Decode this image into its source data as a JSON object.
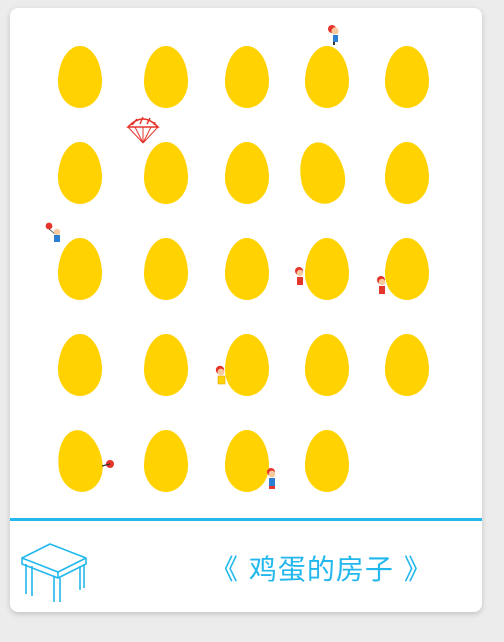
{
  "colors": {
    "egg": "#FFD200",
    "accent": "#22B8EE",
    "background": "#FFFFFF",
    "figure_shirt": "#2A7FD4",
    "figure_red": "#E6352B",
    "figure_skin": "#F6C9A0"
  },
  "title": "《 鸡蛋的房子 》",
  "eggs": [
    {
      "row": 1,
      "count": 5
    },
    {
      "row": 2,
      "count": 5
    },
    {
      "row": 3,
      "count": 5
    },
    {
      "row": 4,
      "count": 5
    },
    {
      "row": 5,
      "count": 4
    }
  ],
  "icons": {
    "table": "table-icon",
    "parachute": "parachute-icon",
    "figure": "child-figure-icon"
  }
}
